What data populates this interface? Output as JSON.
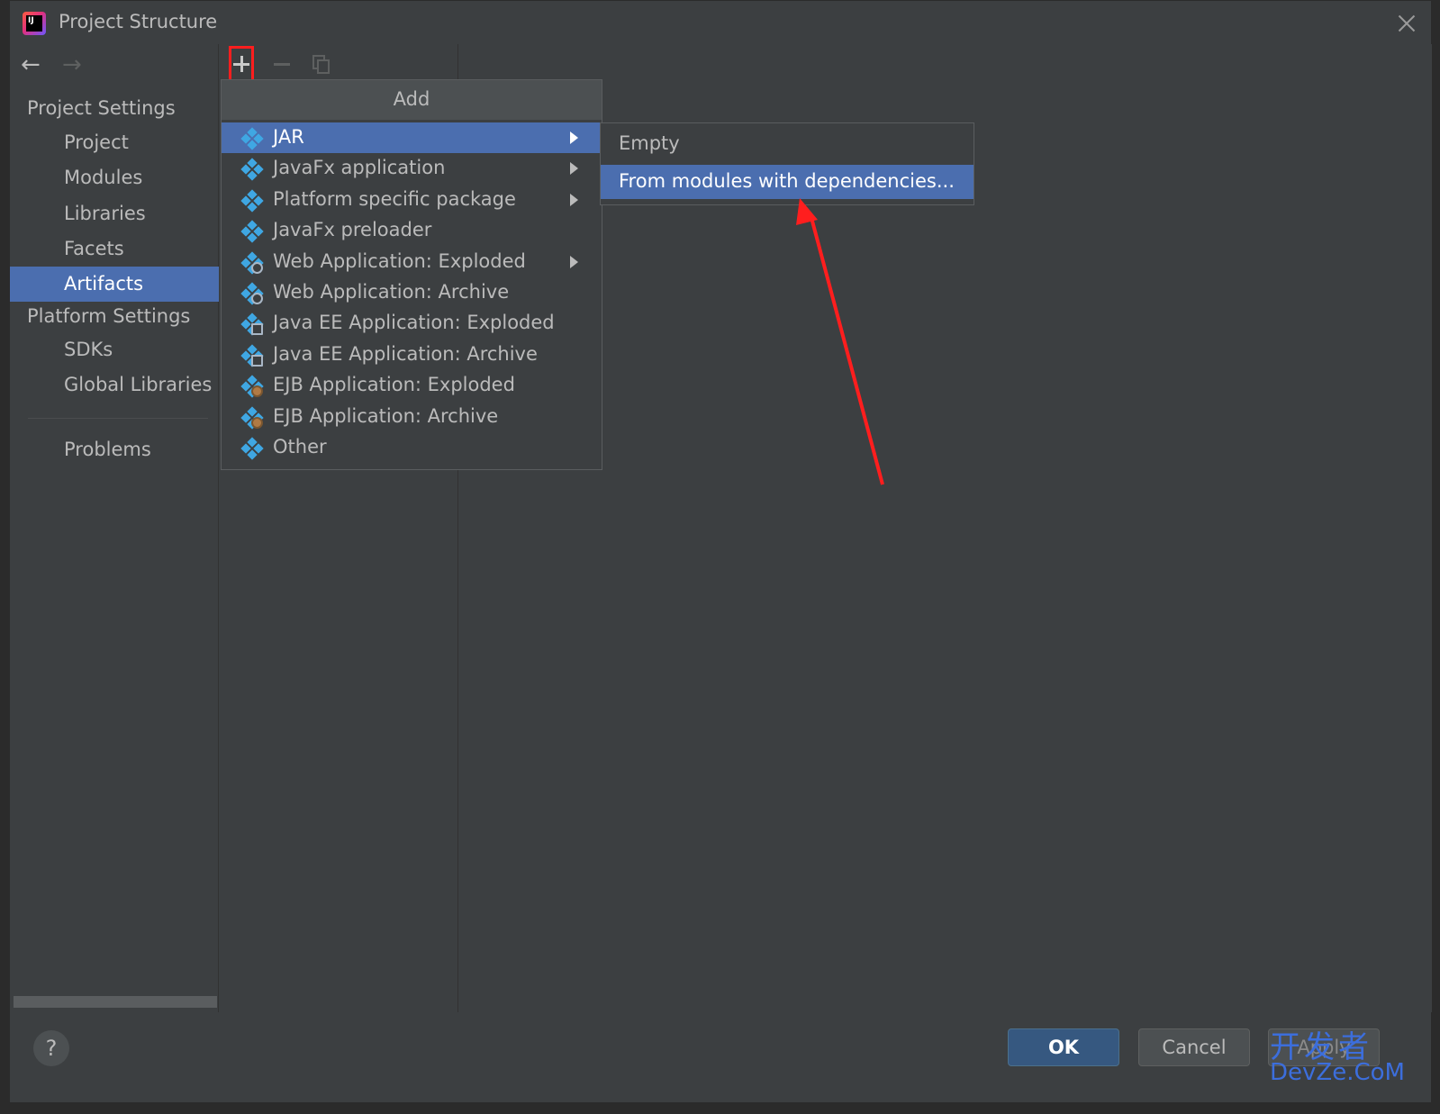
{
  "window": {
    "title": "Project Structure"
  },
  "sidebar": {
    "project_settings_header": "Project Settings",
    "project_items": [
      "Project",
      "Modules",
      "Libraries",
      "Facets",
      "Artifacts"
    ],
    "selected_item": "Artifacts",
    "platform_settings_header": "Platform Settings",
    "platform_items": [
      "SDKs",
      "Global Libraries"
    ],
    "problems": "Problems"
  },
  "add_popup": {
    "header": "Add",
    "items": [
      {
        "label": "JAR",
        "submenu": true,
        "selected": true,
        "icon": "artifact-diamond-icon"
      },
      {
        "label": "JavaFx application",
        "submenu": true,
        "icon": "artifact-diamond-icon"
      },
      {
        "label": "Platform specific package",
        "submenu": true,
        "icon": "artifact-diamond-icon"
      },
      {
        "label": "JavaFx preloader",
        "submenu": false,
        "icon": "artifact-diamond-icon"
      },
      {
        "label": "Web Application: Exploded",
        "submenu": true,
        "icon": "web-artifact-icon"
      },
      {
        "label": "Web Application: Archive",
        "submenu": false,
        "icon": "web-artifact-icon"
      },
      {
        "label": "Java EE Application: Exploded",
        "submenu": false,
        "icon": "javaee-artifact-icon"
      },
      {
        "label": "Java EE Application: Archive",
        "submenu": false,
        "icon": "javaee-artifact-icon"
      },
      {
        "label": "EJB Application: Exploded",
        "submenu": false,
        "icon": "ejb-artifact-icon"
      },
      {
        "label": "EJB Application: Archive",
        "submenu": false,
        "icon": "ejb-artifact-icon"
      },
      {
        "label": "Other",
        "submenu": false,
        "icon": "artifact-diamond-icon"
      }
    ]
  },
  "jar_submenu": {
    "items": [
      {
        "label": "Empty",
        "selected": false
      },
      {
        "label": "From modules with dependencies...",
        "selected": true
      }
    ]
  },
  "buttons": {
    "ok": "OK",
    "cancel": "Cancel",
    "apply": "Apply",
    "help": "?"
  },
  "watermark": {
    "line1": "开发者",
    "line2": "DevZe.CoM"
  },
  "colors": {
    "selection": "#4b6eaf",
    "background": "#3c3f41",
    "highlight_box": "#ff1e1e",
    "annotation_arrow": "#ff1e1e",
    "icon_blue": "#3fa7e3"
  }
}
